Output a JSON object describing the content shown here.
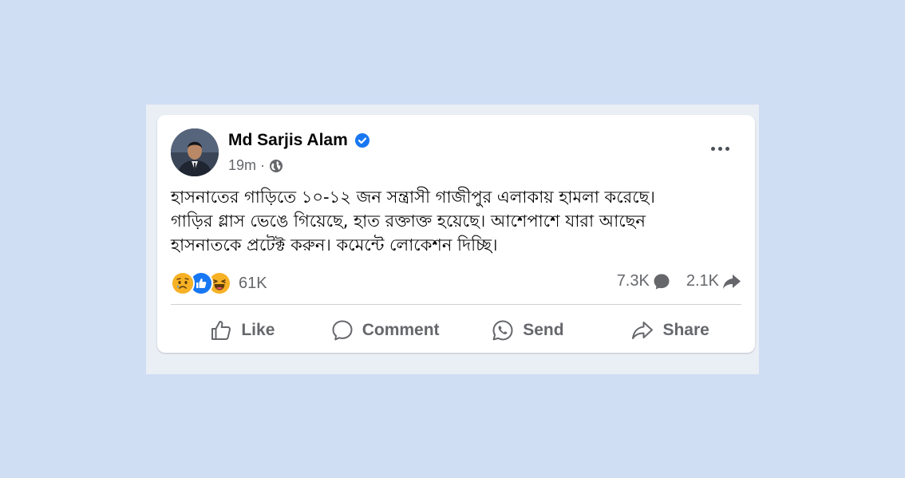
{
  "post": {
    "author": "Md Sarjis Alam",
    "verified": true,
    "time": "19m",
    "separator": "·",
    "audience_icon": "globe-icon",
    "text_lines": [
      "হাসনাতের গাড়িতে ১০-১২ জন সন্ত্রাসী গাজীপুর এলাকায় হামলা করেছে।",
      "গাড়ির গ্লাস ভেঙে গিয়েছে, হাত রক্তাক্ত হয়েছে। আশেপাশে যারা আছেন",
      "হাসনাতকে প্রটেক্ট করুন। কমেন্টে লোকেশন দিচ্ছি।"
    ]
  },
  "reactions": {
    "icons": [
      "sad-reaction-icon",
      "like-reaction-icon",
      "haha-reaction-icon"
    ],
    "count": "61K"
  },
  "stats": {
    "comments": "7.3K",
    "shares": "2.1K"
  },
  "actions": {
    "like": "Like",
    "comment": "Comment",
    "send": "Send",
    "share": "Share"
  },
  "colors": {
    "background": "#cfdef3",
    "card": "#ffffff",
    "verified": "#1877f2",
    "like_blue": "#1877f2",
    "reaction_yellow": "#f7b125",
    "secondary_text": "#65676b"
  }
}
